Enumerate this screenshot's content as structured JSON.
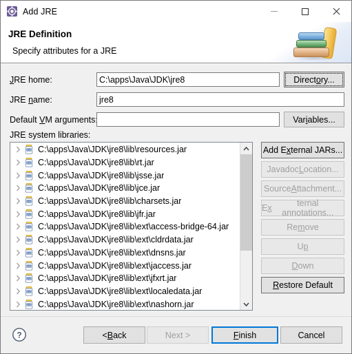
{
  "window": {
    "title": "Add JRE",
    "icon": "jre-gear-icon",
    "controls": {
      "minimize": "minimize-icon",
      "maximize": "maximize-icon",
      "close": "close-icon"
    }
  },
  "header": {
    "title": "JRE Definition",
    "description": "Specify attributes for a JRE",
    "art": "stack-of-books-icon"
  },
  "form": {
    "jre_home": {
      "label_pre": "",
      "label_mnemonic": "J",
      "label_post": "RE home:",
      "value": "C:\\apps\\Java\\JDK\\jre8",
      "placeholder": "",
      "browse_button": {
        "label_pre": "Direct",
        "label_mnemonic": "o",
        "label_post": "ry...",
        "focused": true
      }
    },
    "jre_name": {
      "label_pre": "JRE ",
      "label_mnemonic": "n",
      "label_post": "ame:",
      "value": "jre8",
      "placeholder": ""
    },
    "vm_arguments": {
      "label_pre": "Default ",
      "label_mnemonic": "V",
      "label_post": "M arguments:",
      "value": "",
      "placeholder": "",
      "variables_button": {
        "label_pre": "Var",
        "label_mnemonic": "i",
        "label_post": "ables..."
      }
    },
    "system_libraries_label": "JRE system libraries:"
  },
  "library_tree": {
    "rows": [
      {
        "path": "C:\\apps\\Java\\JDK\\jre8\\lib\\resources.jar",
        "icon": "jar-icon",
        "expandable": true
      },
      {
        "path": "C:\\apps\\Java\\JDK\\jre8\\lib\\rt.jar",
        "icon": "jar-icon",
        "expandable": true
      },
      {
        "path": "C:\\apps\\Java\\JDK\\jre8\\lib\\jsse.jar",
        "icon": "jar-icon",
        "expandable": true
      },
      {
        "path": "C:\\apps\\Java\\JDK\\jre8\\lib\\jce.jar",
        "icon": "jar-icon",
        "expandable": true
      },
      {
        "path": "C:\\apps\\Java\\JDK\\jre8\\lib\\charsets.jar",
        "icon": "jar-icon",
        "expandable": true
      },
      {
        "path": "C:\\apps\\Java\\JDK\\jre8\\lib\\jfr.jar",
        "icon": "jar-icon",
        "expandable": true
      },
      {
        "path": "C:\\apps\\Java\\JDK\\jre8\\lib\\ext\\access-bridge-64.jar",
        "icon": "jar-icon",
        "expandable": true
      },
      {
        "path": "C:\\apps\\Java\\JDK\\jre8\\lib\\ext\\cldrdata.jar",
        "icon": "jar-icon",
        "expandable": true
      },
      {
        "path": "C:\\apps\\Java\\JDK\\jre8\\lib\\ext\\dnsns.jar",
        "icon": "jar-icon",
        "expandable": true
      },
      {
        "path": "C:\\apps\\Java\\JDK\\jre8\\lib\\ext\\jaccess.jar",
        "icon": "jar-icon",
        "expandable": true
      },
      {
        "path": "C:\\apps\\Java\\JDK\\jre8\\lib\\ext\\jfxrt.jar",
        "icon": "jar-icon",
        "expandable": true
      },
      {
        "path": "C:\\apps\\Java\\JDK\\jre8\\lib\\ext\\localedata.jar",
        "icon": "jar-icon",
        "expandable": true
      },
      {
        "path": "C:\\apps\\Java\\JDK\\jre8\\lib\\ext\\nashorn.jar",
        "icon": "jar-icon",
        "expandable": true
      }
    ],
    "scrollbar": {
      "up_arrow": "chevron-up-icon",
      "down_arrow": "chevron-down-icon"
    }
  },
  "side_buttons": [
    {
      "label_pre": "Add E",
      "label_mnemonic": "x",
      "label_post": "ternal JARs...",
      "enabled": true
    },
    {
      "label_pre": "Javadoc ",
      "label_mnemonic": "L",
      "label_post": "ocation...",
      "enabled": false
    },
    {
      "label_pre": "Source ",
      "label_mnemonic": "A",
      "label_post": "ttachment...",
      "enabled": false
    },
    {
      "label_pre": "E",
      "label_mnemonic": "x",
      "label_post": "ternal annotations...",
      "enabled": false
    },
    {
      "label_pre": "Re",
      "label_mnemonic": "m",
      "label_post": "ove",
      "enabled": false
    },
    {
      "label_pre": "U",
      "label_mnemonic": "p",
      "label_post": "",
      "enabled": false
    },
    {
      "label_pre": "",
      "label_mnemonic": "D",
      "label_post": "own",
      "enabled": false
    },
    {
      "label_pre": "",
      "label_mnemonic": "R",
      "label_post": "estore Default",
      "enabled": true
    }
  ],
  "footer": {
    "help": "help-icon",
    "back": {
      "label_pre": "< ",
      "label_mnemonic": "B",
      "label_post": "ack",
      "enabled": true
    },
    "next": {
      "label_pre": "",
      "label_mnemonic": "N",
      "label_post": "ext >",
      "enabled": false
    },
    "finish": {
      "label_pre": "",
      "label_mnemonic": "F",
      "label_post": "inish",
      "enabled": true,
      "default": true
    },
    "cancel": {
      "label_pre": "Cancel",
      "label_mnemonic": "",
      "label_post": "",
      "enabled": true
    }
  },
  "colors": {
    "dialog_bg": "#f0f0f0",
    "header_bg": "#ffffff",
    "accent_focus": "#0078d7",
    "button_bg": "#e1e1e1",
    "disabled_text": "#a0a0a0",
    "border": "#7a7a7a"
  }
}
